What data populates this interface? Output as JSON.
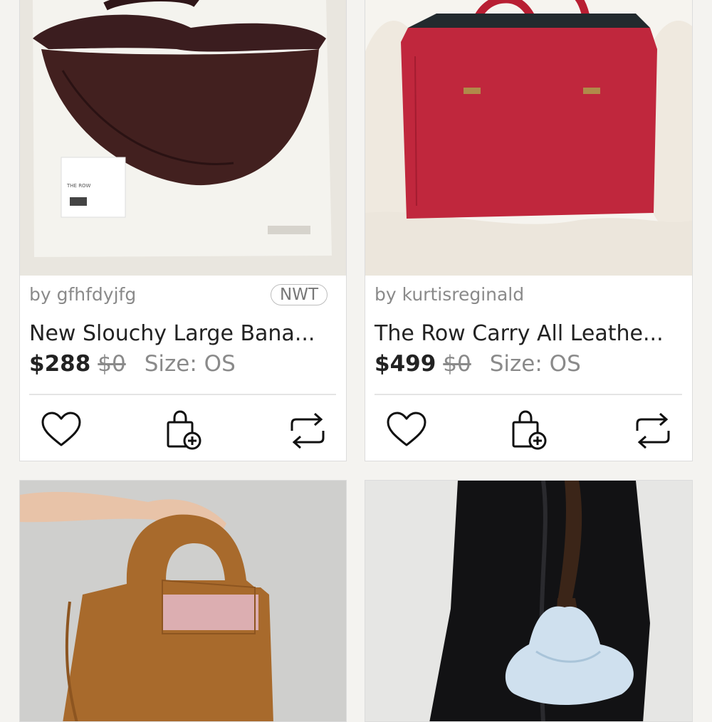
{
  "listings": [
    {
      "seller": "by gfhfdyjfg",
      "badge": "NWT",
      "title": "New  Slouchy Large Bana...",
      "price": "$288",
      "original_price": "$0",
      "size": "Size: OS",
      "photo_text": "THE ROW",
      "colors": {
        "bag": "#3b1d1f",
        "background": "#e9e6df"
      }
    },
    {
      "seller": "by kurtisreginald",
      "badge": "",
      "title": "The Row Carry All Leathe...",
      "price": "$499",
      "original_price": "$0",
      "size": "Size: OS",
      "colors": {
        "bag": "#c0273d",
        "background": "#f6f4ef"
      }
    },
    {
      "colors": {
        "bag": "#a86a2c",
        "background": "#cfcfcd"
      }
    },
    {
      "colors": {
        "bag": "#cfe0ee",
        "background": "#e6e6e4"
      }
    }
  ],
  "actions": {
    "like_icon": "heart-icon",
    "bundle_icon": "shopping-bag-plus-icon",
    "share_icon": "share-repeat-icon"
  },
  "colors": {
    "page_bg": "#f4f3f0",
    "text": "#222222",
    "muted": "#8a8a8a"
  }
}
